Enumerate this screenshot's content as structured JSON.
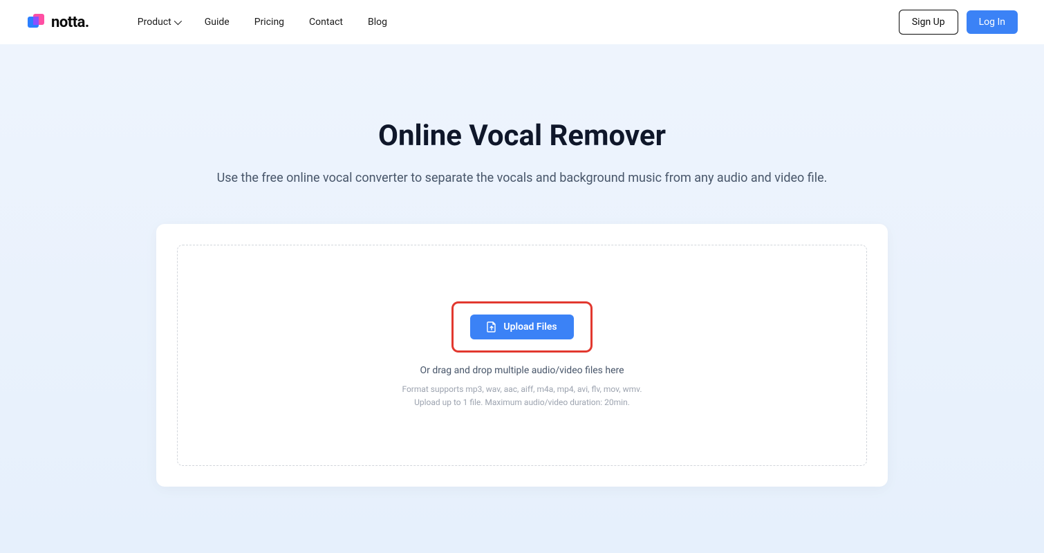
{
  "header": {
    "logo_text": "notta.",
    "nav": {
      "product": "Product",
      "guide": "Guide",
      "pricing": "Pricing",
      "contact": "Contact",
      "blog": "Blog"
    },
    "signup": "Sign Up",
    "login": "Log In"
  },
  "main": {
    "title": "Online Vocal Remover",
    "subtitle": "Use the free online vocal converter to separate the vocals and background music from any audio and video file.",
    "upload_button": "Upload Files",
    "drop_text": "Or drag and drop multiple audio/video files here",
    "format_hint": "Format supports mp3, wav, aac, aiff, m4a, mp4, avi, flv, mov, wmv.",
    "limit_hint": "Upload up to 1 file. Maximum audio/video duration: 20min."
  }
}
